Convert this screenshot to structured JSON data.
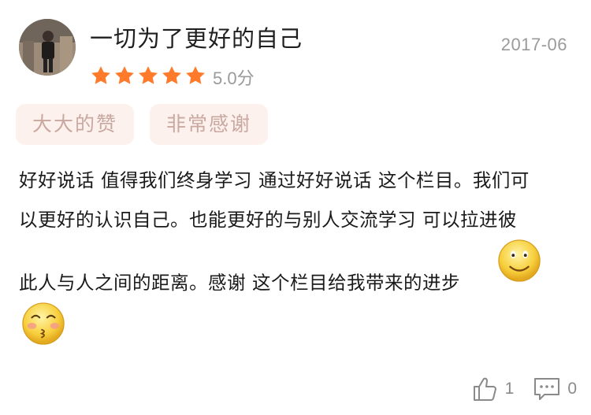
{
  "review": {
    "username": "一切为了更好的自己",
    "date": "2017-06",
    "rating": 5,
    "score_text": "5.0分",
    "tags": [
      "大大的赞",
      "非常感谢"
    ],
    "body_lines": [
      "好好说话 值得我们终身学习 通过好好说话 这个栏目。我们可",
      "以更好的认识自己。也能更好的与别人交流学习 可以拉进彼",
      "此人与人之间的距离。感谢 这个栏目给我带来的进步"
    ],
    "emojis": [
      "smiley-emoji",
      "blushing-kiss-emoji"
    ]
  },
  "actions": {
    "like_count": "1",
    "comment_count": "0"
  },
  "colors": {
    "star": "#ff7a2a",
    "tag_bg": "#fdf1ee",
    "tag_text": "#c9a8a0",
    "meta_text": "#9a9a9a"
  }
}
